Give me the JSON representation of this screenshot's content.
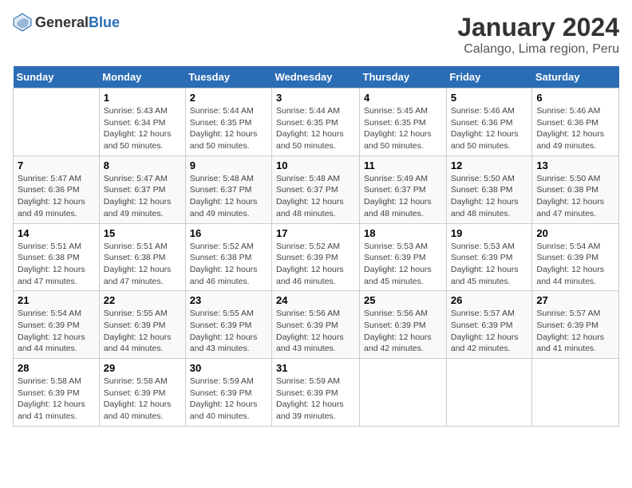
{
  "header": {
    "logo_general": "General",
    "logo_blue": "Blue",
    "title": "January 2024",
    "subtitle": "Calango, Lima region, Peru"
  },
  "calendar": {
    "days_of_week": [
      "Sunday",
      "Monday",
      "Tuesday",
      "Wednesday",
      "Thursday",
      "Friday",
      "Saturday"
    ],
    "weeks": [
      [
        {
          "day": "",
          "info": ""
        },
        {
          "day": "1",
          "info": "Sunrise: 5:43 AM\nSunset: 6:34 PM\nDaylight: 12 hours\nand 50 minutes."
        },
        {
          "day": "2",
          "info": "Sunrise: 5:44 AM\nSunset: 6:35 PM\nDaylight: 12 hours\nand 50 minutes."
        },
        {
          "day": "3",
          "info": "Sunrise: 5:44 AM\nSunset: 6:35 PM\nDaylight: 12 hours\nand 50 minutes."
        },
        {
          "day": "4",
          "info": "Sunrise: 5:45 AM\nSunset: 6:35 PM\nDaylight: 12 hours\nand 50 minutes."
        },
        {
          "day": "5",
          "info": "Sunrise: 5:46 AM\nSunset: 6:36 PM\nDaylight: 12 hours\nand 50 minutes."
        },
        {
          "day": "6",
          "info": "Sunrise: 5:46 AM\nSunset: 6:36 PM\nDaylight: 12 hours\nand 49 minutes."
        }
      ],
      [
        {
          "day": "7",
          "info": "Sunrise: 5:47 AM\nSunset: 6:36 PM\nDaylight: 12 hours\nand 49 minutes."
        },
        {
          "day": "8",
          "info": "Sunrise: 5:47 AM\nSunset: 6:37 PM\nDaylight: 12 hours\nand 49 minutes."
        },
        {
          "day": "9",
          "info": "Sunrise: 5:48 AM\nSunset: 6:37 PM\nDaylight: 12 hours\nand 49 minutes."
        },
        {
          "day": "10",
          "info": "Sunrise: 5:48 AM\nSunset: 6:37 PM\nDaylight: 12 hours\nand 48 minutes."
        },
        {
          "day": "11",
          "info": "Sunrise: 5:49 AM\nSunset: 6:37 PM\nDaylight: 12 hours\nand 48 minutes."
        },
        {
          "day": "12",
          "info": "Sunrise: 5:50 AM\nSunset: 6:38 PM\nDaylight: 12 hours\nand 48 minutes."
        },
        {
          "day": "13",
          "info": "Sunrise: 5:50 AM\nSunset: 6:38 PM\nDaylight: 12 hours\nand 47 minutes."
        }
      ],
      [
        {
          "day": "14",
          "info": "Sunrise: 5:51 AM\nSunset: 6:38 PM\nDaylight: 12 hours\nand 47 minutes."
        },
        {
          "day": "15",
          "info": "Sunrise: 5:51 AM\nSunset: 6:38 PM\nDaylight: 12 hours\nand 47 minutes."
        },
        {
          "day": "16",
          "info": "Sunrise: 5:52 AM\nSunset: 6:38 PM\nDaylight: 12 hours\nand 46 minutes."
        },
        {
          "day": "17",
          "info": "Sunrise: 5:52 AM\nSunset: 6:39 PM\nDaylight: 12 hours\nand 46 minutes."
        },
        {
          "day": "18",
          "info": "Sunrise: 5:53 AM\nSunset: 6:39 PM\nDaylight: 12 hours\nand 45 minutes."
        },
        {
          "day": "19",
          "info": "Sunrise: 5:53 AM\nSunset: 6:39 PM\nDaylight: 12 hours\nand 45 minutes."
        },
        {
          "day": "20",
          "info": "Sunrise: 5:54 AM\nSunset: 6:39 PM\nDaylight: 12 hours\nand 44 minutes."
        }
      ],
      [
        {
          "day": "21",
          "info": "Sunrise: 5:54 AM\nSunset: 6:39 PM\nDaylight: 12 hours\nand 44 minutes."
        },
        {
          "day": "22",
          "info": "Sunrise: 5:55 AM\nSunset: 6:39 PM\nDaylight: 12 hours\nand 44 minutes."
        },
        {
          "day": "23",
          "info": "Sunrise: 5:55 AM\nSunset: 6:39 PM\nDaylight: 12 hours\nand 43 minutes."
        },
        {
          "day": "24",
          "info": "Sunrise: 5:56 AM\nSunset: 6:39 PM\nDaylight: 12 hours\nand 43 minutes."
        },
        {
          "day": "25",
          "info": "Sunrise: 5:56 AM\nSunset: 6:39 PM\nDaylight: 12 hours\nand 42 minutes."
        },
        {
          "day": "26",
          "info": "Sunrise: 5:57 AM\nSunset: 6:39 PM\nDaylight: 12 hours\nand 42 minutes."
        },
        {
          "day": "27",
          "info": "Sunrise: 5:57 AM\nSunset: 6:39 PM\nDaylight: 12 hours\nand 41 minutes."
        }
      ],
      [
        {
          "day": "28",
          "info": "Sunrise: 5:58 AM\nSunset: 6:39 PM\nDaylight: 12 hours\nand 41 minutes."
        },
        {
          "day": "29",
          "info": "Sunrise: 5:58 AM\nSunset: 6:39 PM\nDaylight: 12 hours\nand 40 minutes."
        },
        {
          "day": "30",
          "info": "Sunrise: 5:59 AM\nSunset: 6:39 PM\nDaylight: 12 hours\nand 40 minutes."
        },
        {
          "day": "31",
          "info": "Sunrise: 5:59 AM\nSunset: 6:39 PM\nDaylight: 12 hours\nand 39 minutes."
        },
        {
          "day": "",
          "info": ""
        },
        {
          "day": "",
          "info": ""
        },
        {
          "day": "",
          "info": ""
        }
      ]
    ]
  }
}
